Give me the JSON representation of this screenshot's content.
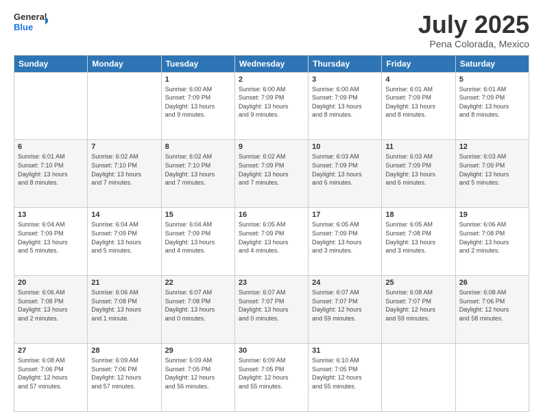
{
  "logo": {
    "general": "General",
    "blue": "Blue"
  },
  "header": {
    "title": "July 2025",
    "subtitle": "Pena Colorada, Mexico"
  },
  "days_of_week": [
    "Sunday",
    "Monday",
    "Tuesday",
    "Wednesday",
    "Thursday",
    "Friday",
    "Saturday"
  ],
  "weeks": [
    [
      {
        "day": "",
        "info": ""
      },
      {
        "day": "",
        "info": ""
      },
      {
        "day": "1",
        "info": "Sunrise: 6:00 AM\nSunset: 7:09 PM\nDaylight: 13 hours\nand 9 minutes."
      },
      {
        "day": "2",
        "info": "Sunrise: 6:00 AM\nSunset: 7:09 PM\nDaylight: 13 hours\nand 9 minutes."
      },
      {
        "day": "3",
        "info": "Sunrise: 6:00 AM\nSunset: 7:09 PM\nDaylight: 13 hours\nand 8 minutes."
      },
      {
        "day": "4",
        "info": "Sunrise: 6:01 AM\nSunset: 7:09 PM\nDaylight: 13 hours\nand 8 minutes."
      },
      {
        "day": "5",
        "info": "Sunrise: 6:01 AM\nSunset: 7:09 PM\nDaylight: 13 hours\nand 8 minutes."
      }
    ],
    [
      {
        "day": "6",
        "info": "Sunrise: 6:01 AM\nSunset: 7:10 PM\nDaylight: 13 hours\nand 8 minutes."
      },
      {
        "day": "7",
        "info": "Sunrise: 6:02 AM\nSunset: 7:10 PM\nDaylight: 13 hours\nand 7 minutes."
      },
      {
        "day": "8",
        "info": "Sunrise: 6:02 AM\nSunset: 7:10 PM\nDaylight: 13 hours\nand 7 minutes."
      },
      {
        "day": "9",
        "info": "Sunrise: 6:02 AM\nSunset: 7:09 PM\nDaylight: 13 hours\nand 7 minutes."
      },
      {
        "day": "10",
        "info": "Sunrise: 6:03 AM\nSunset: 7:09 PM\nDaylight: 13 hours\nand 6 minutes."
      },
      {
        "day": "11",
        "info": "Sunrise: 6:03 AM\nSunset: 7:09 PM\nDaylight: 13 hours\nand 6 minutes."
      },
      {
        "day": "12",
        "info": "Sunrise: 6:03 AM\nSunset: 7:09 PM\nDaylight: 13 hours\nand 5 minutes."
      }
    ],
    [
      {
        "day": "13",
        "info": "Sunrise: 6:04 AM\nSunset: 7:09 PM\nDaylight: 13 hours\nand 5 minutes."
      },
      {
        "day": "14",
        "info": "Sunrise: 6:04 AM\nSunset: 7:09 PM\nDaylight: 13 hours\nand 5 minutes."
      },
      {
        "day": "15",
        "info": "Sunrise: 6:04 AM\nSunset: 7:09 PM\nDaylight: 13 hours\nand 4 minutes."
      },
      {
        "day": "16",
        "info": "Sunrise: 6:05 AM\nSunset: 7:09 PM\nDaylight: 13 hours\nand 4 minutes."
      },
      {
        "day": "17",
        "info": "Sunrise: 6:05 AM\nSunset: 7:09 PM\nDaylight: 13 hours\nand 3 minutes."
      },
      {
        "day": "18",
        "info": "Sunrise: 6:05 AM\nSunset: 7:08 PM\nDaylight: 13 hours\nand 3 minutes."
      },
      {
        "day": "19",
        "info": "Sunrise: 6:06 AM\nSunset: 7:08 PM\nDaylight: 13 hours\nand 2 minutes."
      }
    ],
    [
      {
        "day": "20",
        "info": "Sunrise: 6:06 AM\nSunset: 7:08 PM\nDaylight: 13 hours\nand 2 minutes."
      },
      {
        "day": "21",
        "info": "Sunrise: 6:06 AM\nSunset: 7:08 PM\nDaylight: 13 hours\nand 1 minute."
      },
      {
        "day": "22",
        "info": "Sunrise: 6:07 AM\nSunset: 7:08 PM\nDaylight: 13 hours\nand 0 minutes."
      },
      {
        "day": "23",
        "info": "Sunrise: 6:07 AM\nSunset: 7:07 PM\nDaylight: 13 hours\nand 0 minutes."
      },
      {
        "day": "24",
        "info": "Sunrise: 6:07 AM\nSunset: 7:07 PM\nDaylight: 12 hours\nand 59 minutes."
      },
      {
        "day": "25",
        "info": "Sunrise: 6:08 AM\nSunset: 7:07 PM\nDaylight: 12 hours\nand 59 minutes."
      },
      {
        "day": "26",
        "info": "Sunrise: 6:08 AM\nSunset: 7:06 PM\nDaylight: 12 hours\nand 58 minutes."
      }
    ],
    [
      {
        "day": "27",
        "info": "Sunrise: 6:08 AM\nSunset: 7:06 PM\nDaylight: 12 hours\nand 57 minutes."
      },
      {
        "day": "28",
        "info": "Sunrise: 6:09 AM\nSunset: 7:06 PM\nDaylight: 12 hours\nand 57 minutes."
      },
      {
        "day": "29",
        "info": "Sunrise: 6:09 AM\nSunset: 7:05 PM\nDaylight: 12 hours\nand 56 minutes."
      },
      {
        "day": "30",
        "info": "Sunrise: 6:09 AM\nSunset: 7:05 PM\nDaylight: 12 hours\nand 55 minutes."
      },
      {
        "day": "31",
        "info": "Sunrise: 6:10 AM\nSunset: 7:05 PM\nDaylight: 12 hours\nand 55 minutes."
      },
      {
        "day": "",
        "info": ""
      },
      {
        "day": "",
        "info": ""
      }
    ]
  ]
}
